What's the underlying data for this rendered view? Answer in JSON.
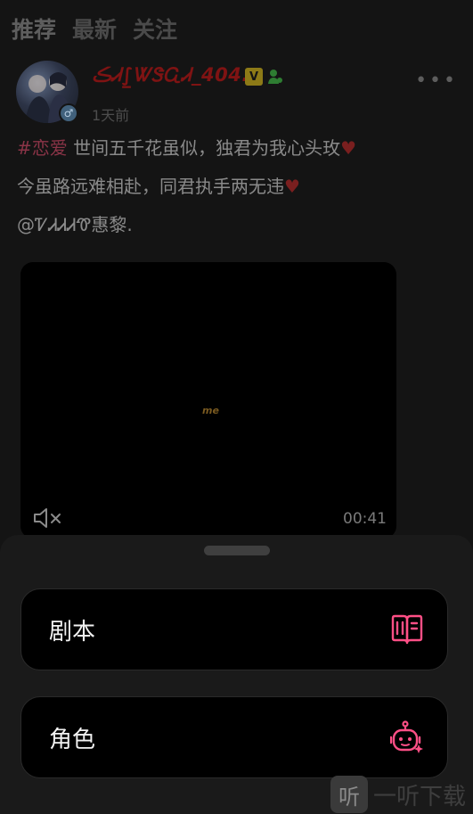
{
  "tabs": [
    {
      "label": "推荐"
    },
    {
      "label": "最新"
    },
    {
      "label": "关注"
    }
  ],
  "post": {
    "username": "ڪᏗ⨜ᏔᏕᏩᏗ_404.",
    "verified_badge": "V",
    "time": "1天前",
    "hashtag": "#恋爱",
    "line1": " 世间五千花虽似，独君为我心头玫",
    "line2": "今虽路远难相赴，同君执手两无违",
    "line3": "@ᏤᏗᏗᏗᏡ惠黎.",
    "heart": "♥",
    "gender_icon": "male-icon",
    "more_icon": "more-dots-icon"
  },
  "video": {
    "logo_text": "me",
    "duration": "00:41",
    "mute_icon": "volume-muted-icon"
  },
  "sheet": {
    "options": [
      {
        "label": "剧本",
        "icon": "book-icon"
      },
      {
        "label": "角色",
        "icon": "robot-icon"
      }
    ]
  },
  "watermark": {
    "glyph": "听",
    "text": "一听下载"
  },
  "colors": {
    "background": "#141414",
    "accent_pink": "#ff4f86",
    "username_red": "#7f1313",
    "sheet_bg": "#1a1a1a"
  }
}
